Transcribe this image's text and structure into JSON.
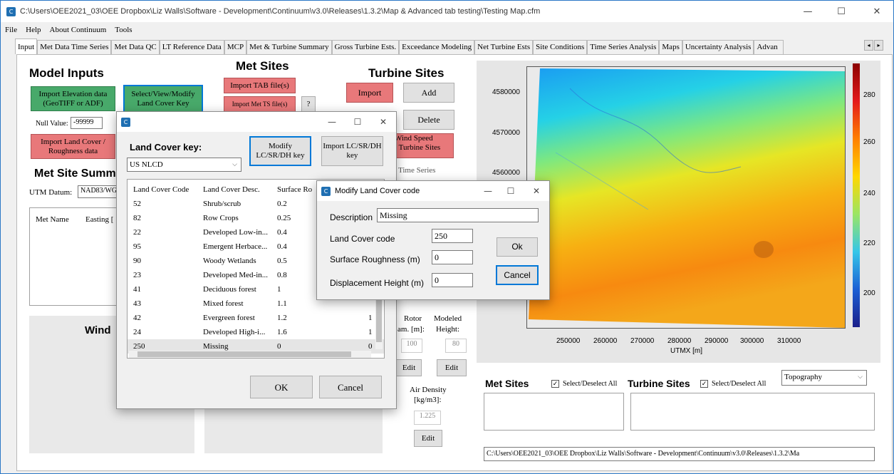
{
  "window": {
    "title": "C:\\Users\\OEE2021_03\\OEE Dropbox\\Liz Walls\\Software - Development\\Continuum\\v3.0\\Releases\\1.3.2\\Map & Advanced tab testing\\Testing Map.cfm",
    "minimize": "—",
    "maximize": "☐",
    "close": "✕"
  },
  "menu": [
    "File",
    "Help",
    "About Continuum",
    "Tools"
  ],
  "tabs": [
    "Input",
    "Met Data Time Series",
    "Met Data QC",
    "LT Reference Data",
    "MCP",
    "Met & Turbine Summary",
    "Gross Turbine Ests.",
    "Exceedance Modeling",
    "Net Turbine Ests",
    "Site Conditions",
    "Time Series Analysis",
    "Maps",
    "Uncertainty Analysis",
    "Advan"
  ],
  "tab_scroll": {
    "left": "◂",
    "right": "▸"
  },
  "model_inputs": {
    "title": "Model Inputs",
    "import_elevation": "Import Elevation data (GeoTIFF or ADF)",
    "select_view_modify": "Select/View/Modify Land Cover Key",
    "null_value_label": "Null Value:",
    "null_value": "-99999",
    "import_land_cover": "Import Land Cover / Roughness data",
    "met_site_summary": "Met Site Summ",
    "utm_datum_label": "UTM Datum:",
    "utm_datum_value": "NAD83/WGS",
    "met_name_col": "Met Name",
    "easting_col": "Easting [",
    "wind_label": "Wind"
  },
  "met_sites": {
    "title": "Met Sites",
    "import_tab": "Import TAB file(s)",
    "import_ts": "Import Met TS file(s)",
    "help": "?"
  },
  "turbine_sites": {
    "title": "Turbine Sites",
    "import": "Import",
    "add": "Add",
    "delete": "Delete",
    "wind_speed_1": "Wind Speed",
    "wind_speed_2": "t Turbine Sites",
    "time_series": "Time Series",
    "rotor_label": "Rotor",
    "rotor_label2": "am. [m]:",
    "modeled_label": "Modeled",
    "modeled_label2": "Height:",
    "rotor_value": "100",
    "height_value": "80",
    "edit1": "Edit",
    "edit2": "Edit",
    "air_density_1": "Air Density",
    "air_density_2": "[kg/m3]:",
    "air_density_value": "1.225",
    "edit3": "Edit"
  },
  "map": {
    "y_ticks": [
      "4580000",
      "4570000",
      "4560000"
    ],
    "x_ticks": [
      "250000",
      "260000",
      "270000",
      "280000",
      "290000",
      "300000",
      "310000"
    ],
    "xlabel": "UTMX [m]",
    "colorbar_ticks": [
      "280",
      "260",
      "240",
      "220",
      "200"
    ]
  },
  "bottom_right": {
    "met_sites": "Met Sites",
    "select_all_1": "Select/Deselect All",
    "turbine_sites": "Turbine Sites",
    "select_all_2": "Select/Deselect All",
    "map_type": "Topography",
    "path": "C:\\Users\\OEE2021_03\\OEE Dropbox\\Liz Walls\\Software - Development\\Continuum\\v3.0\\Releases\\1.3.2\\Ma"
  },
  "land_cover_dialog": {
    "title": "",
    "key_label": "Land Cover key:",
    "key_value": "US NLCD",
    "modify_btn": "Modify LC/SR/DH key",
    "import_btn": "Import LC/SR/DH key",
    "columns": [
      "Land Cover Code",
      "Land Cover Desc.",
      "Surface Ro"
    ],
    "rows": [
      [
        "52",
        "Shrub/scrub",
        "0.2",
        ""
      ],
      [
        "82",
        "Row Crops",
        "0.25",
        ""
      ],
      [
        "22",
        "Developed Low-in...",
        "0.4",
        ""
      ],
      [
        "95",
        "Emergent Herbace...",
        "0.4",
        ""
      ],
      [
        "90",
        "Woody Wetlands",
        "0.5",
        ""
      ],
      [
        "23",
        "Developed Med-in...",
        "0.8",
        ""
      ],
      [
        "41",
        "Deciduous forest",
        "1",
        ""
      ],
      [
        "43",
        "Mixed forest",
        "1.1",
        ""
      ],
      [
        "42",
        "Evergreen forest",
        "1.2",
        "1"
      ],
      [
        "24",
        "Developed High-i...",
        "1.6",
        "1"
      ],
      [
        "250",
        "Missing",
        "0",
        "0"
      ]
    ],
    "ok": "OK",
    "cancel": "Cancel"
  },
  "modify_dialog": {
    "title": "Modify Land Cover code",
    "description_label": "Description",
    "description_value": "Missing",
    "code_label": "Land Cover code",
    "code_value": "250",
    "roughness_label": "Surface Roughness (m)",
    "roughness_value": "0",
    "displacement_label": "Displacement Height (m)",
    "displacement_value": "0",
    "ok": "Ok",
    "cancel": "Cancel"
  }
}
